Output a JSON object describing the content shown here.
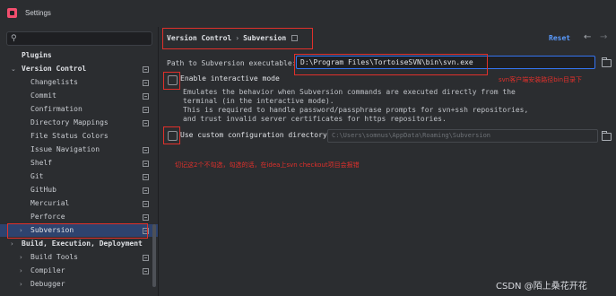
{
  "window": {
    "title": "Settings"
  },
  "sidebar": {
    "search_placeholder": "",
    "items": [
      {
        "label": "Plugins"
      },
      {
        "label": "Version Control"
      },
      {
        "label": "Changelists"
      },
      {
        "label": "Commit"
      },
      {
        "label": "Confirmation"
      },
      {
        "label": "Directory Mappings"
      },
      {
        "label": "File Status Colors"
      },
      {
        "label": "Issue Navigation"
      },
      {
        "label": "Shelf"
      },
      {
        "label": "Git"
      },
      {
        "label": "GitHub"
      },
      {
        "label": "Mercurial"
      },
      {
        "label": "Perforce"
      },
      {
        "label": "Subversion"
      },
      {
        "label": "Build, Execution, Deployment"
      },
      {
        "label": "Build Tools"
      },
      {
        "label": "Compiler"
      },
      {
        "label": "Debugger"
      }
    ]
  },
  "header": {
    "breadcrumb_parent": "Version Control",
    "breadcrumb_sep": "›",
    "breadcrumb_current": "Subversion",
    "reset_label": "Reset",
    "back_glyph": "←",
    "forward_glyph": "→"
  },
  "form": {
    "path_label": "Path to Subversion executable:",
    "path_value": "D:\\Program Files\\TortoiseSVN\\bin\\svn.exe",
    "interactive_label": "Enable interactive mode",
    "interactive_desc": [
      "Emulates the behavior when Subversion commands are executed directly from the",
      "terminal (in the interactive mode).",
      "This is required to handle password/passphrase prompts for svn+ssh repositories,",
      "and trust invalid server certificates for https repositories."
    ],
    "custom_config_label": "Use custom configuration directory:",
    "custom_config_value": "C:\\Users\\somnus\\AppData\\Roaming\\Subversion"
  },
  "annotations": {
    "path_note": "svn客户端安装路径bin目录下",
    "checkbox_note": "切记这2个不勾选，勾选的话，在idea上svn checkout项目会报错"
  },
  "watermark": "CSDN @陌上桑花开花"
}
